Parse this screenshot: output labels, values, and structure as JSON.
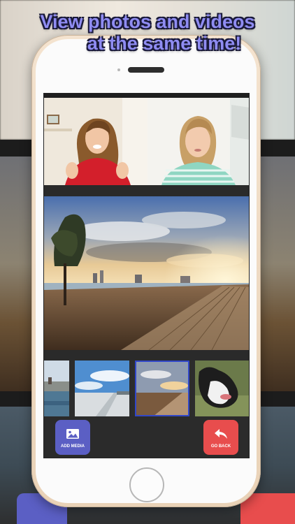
{
  "headline": {
    "line1": "View photos and videos",
    "line2": "at the same time!"
  },
  "toolbar": {
    "add_media_label": "ADD MEDIA",
    "go_back_label": "GO BACK"
  },
  "icons": {
    "add_media": "image-icon",
    "go_back": "reply-arrow-icon"
  },
  "colors": {
    "headline": "#8f8cf2",
    "add_media_button": "#5b5fc4",
    "go_back_button": "#e84d4d",
    "selected_thumbnail_border": "#3147c9"
  },
  "thumbnails": [
    {
      "name": "harbor"
    },
    {
      "name": "pier"
    },
    {
      "name": "boardwalk-sunset",
      "selected": true
    },
    {
      "name": "dog"
    }
  ]
}
